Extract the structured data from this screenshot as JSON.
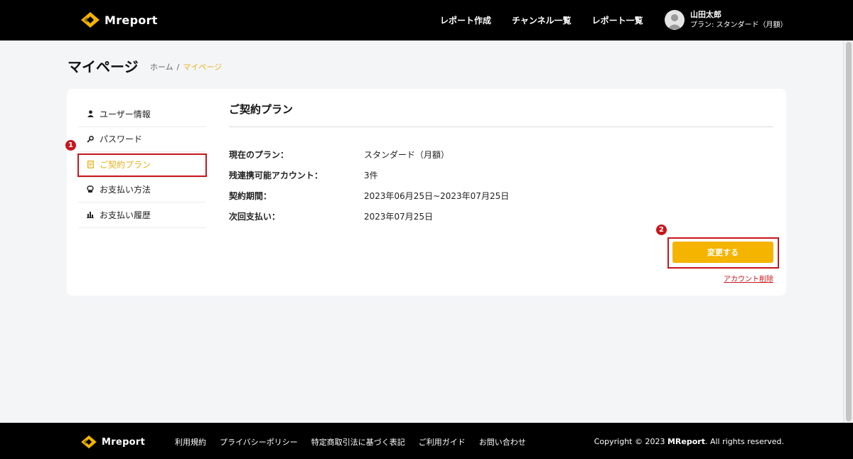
{
  "brand": {
    "name": "Mreport",
    "accent_color": "#f4b400",
    "highlight_color": "#c8161d"
  },
  "header": {
    "nav": [
      "レポート作成",
      "チャンネル一覧",
      "レポート一覧"
    ],
    "user": {
      "name": "山田太郎",
      "plan": "プラン: スタンダード（月額）",
      "avatar_icon": "user-avatar-icon"
    }
  },
  "page": {
    "title": "マイページ",
    "breadcrumb": {
      "home": "ホーム",
      "separator": "/",
      "current": "マイページ"
    }
  },
  "sidebar": {
    "items": [
      {
        "label": "ユーザー情報",
        "icon": "user-icon"
      },
      {
        "label": "パスワード",
        "icon": "key-icon"
      },
      {
        "label": "ご契約プラン",
        "icon": "document-icon",
        "active": true
      },
      {
        "label": "お支払い方法",
        "icon": "wallet-icon"
      },
      {
        "label": "お支払い履歴",
        "icon": "bar-chart-icon"
      }
    ]
  },
  "contract": {
    "title": "ご契約プラン",
    "rows": [
      {
        "label": "現在のプラン：",
        "value": "スタンダード（月額）"
      },
      {
        "label": "残連携可能アカウント：",
        "value": "3件"
      },
      {
        "label": "契約期間：",
        "value": "2023年06月25日~2023年07月25日"
      },
      {
        "label": "次回支払い：",
        "value": "2023年07月25日"
      }
    ],
    "change_button": "変更する",
    "delete_link": "アカウント削除"
  },
  "annotations": {
    "marker_1": "1",
    "marker_2": "2"
  },
  "footer": {
    "brand": "Mreport",
    "links": [
      "利用規約",
      "プライバシーポリシー",
      "特定商取引法に基づく表記",
      "ご利用ガイド",
      "お問い合わせ"
    ],
    "copyright_prefix": "Copyright © 2023 ",
    "copyright_brand": "MReport",
    "copyright_suffix": ". All rights reserved."
  }
}
